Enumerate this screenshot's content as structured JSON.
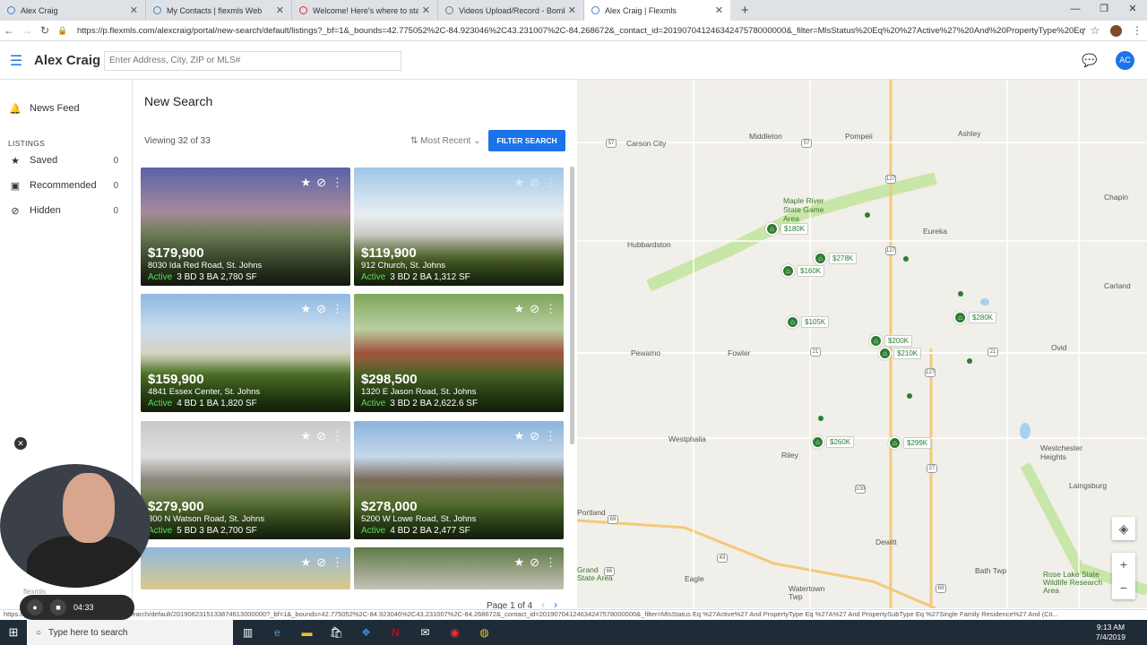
{
  "browser": {
    "tabs": [
      {
        "title": "Alex Craig"
      },
      {
        "title": "My Contacts | flexmls Web"
      },
      {
        "title": "Welcome! Here's where to start..."
      },
      {
        "title": "Videos Upload/Record - Bombb..."
      },
      {
        "title": "Alex Craig | Flexmls"
      }
    ],
    "url": "https://p.flexmls.com/alexcraig/portal/new-search/default/listings?_bf=1&_bounds=42.775052%2C-84.923046%2C43.231007%2C-84.268672&_contact_id=20190704124634247578000000&_filter=MlsStatus%20Eq%20%27Active%27%20And%20PropertyType%20Eq%20%2..."
  },
  "app": {
    "name": "Alex Craig",
    "search_placeholder": "Enter Address, City, ZIP or MLS#",
    "avatar_initials": "AC"
  },
  "sidebar": {
    "news_feed": "News Feed",
    "listings_header": "LISTINGS",
    "items": [
      {
        "label": "Saved",
        "count": "0"
      },
      {
        "label": "Recommended",
        "count": "0"
      },
      {
        "label": "Hidden",
        "count": "0"
      }
    ]
  },
  "list": {
    "title": "New Search",
    "viewing": "Viewing 32 of 33",
    "sort": "Most Recent",
    "filter_button": "FILTER SEARCH",
    "pager": "Page 1 of 4",
    "cards": [
      {
        "price": "$179,900",
        "address": "8030 Ida Red Road, St. Johns",
        "status": "Active",
        "details": "3 BD  3 BA  2,780 SF"
      },
      {
        "price": "$119,900",
        "address": "912 Church, St. Johns",
        "status": "Active",
        "details": "3 BD  2 BA  1,312 SF"
      },
      {
        "price": "$159,900",
        "address": "4841 Essex Center, St. Johns",
        "status": "Active",
        "details": "4 BD  1 BA  1,820 SF"
      },
      {
        "price": "$298,500",
        "address": "1320 E Jason Road, St. Johns",
        "status": "Active",
        "details": "3 BD  2 BA  2,622.6 SF"
      },
      {
        "price": "$279,900",
        "address": "300 N Watson Road, St. Johns",
        "status": "Active",
        "details": "5 BD  3 BA  2,700 SF"
      },
      {
        "price": "$278,000",
        "address": "5200 W Lowe Road, St. Johns",
        "status": "Active",
        "details": "4 BD  2 BA  2,477 SF"
      },
      {
        "price": "",
        "address": "",
        "status": "",
        "details": ""
      },
      {
        "price": "",
        "address": "",
        "status": "",
        "details": ""
      }
    ]
  },
  "map": {
    "towns": [
      "Carson City",
      "Middleton",
      "Pompeii",
      "Ashley",
      "Hubbardston",
      "Maple River State Game Area",
      "Eureka",
      "Chapin",
      "Carland",
      "Pewamo",
      "Fowler",
      "Ovid",
      "Westphalia",
      "Riley",
      "Westchester Heights",
      "Laingsburg",
      "Portland",
      "Dewitt",
      "Eagle",
      "Watertown Twp",
      "Bath Twp",
      "Rose Lake State Wildlife Research Area",
      "Grand State Area"
    ],
    "pins": [
      "$180K",
      "$278K",
      "$160K",
      "$105K",
      "$280K",
      "$200K",
      "$210K",
      "$260K",
      "$299K"
    ],
    "routes": [
      "57",
      "57",
      "127",
      "127",
      "21",
      "21",
      "27",
      "100",
      "127",
      "69",
      "69",
      "43",
      "66"
    ]
  },
  "status_url": "https://p.flexmls.com/alexcraig/portal/new-search/default/2019062315133874613000000?_bf=1&_bounds=42.775052%2C-84.923046%2C43.231007%2C-84.268672&_contact_id=20190704124634247578000000&_filter=MlsStatus Eq %27Active%27 And PropertyType Eq %27A%27 And PropertySubType Eq %27Single Family Residence%27 And (Cit...",
  "recording": {
    "time": "04:33",
    "brand": "flexmls"
  },
  "taskbar": {
    "search": "Type here to search",
    "time": "9:13 AM",
    "date": "7/4/2019"
  },
  "colors": {
    "accent": "#1a73e8",
    "pin": "#2e7d32",
    "active": "#5fdc5f"
  }
}
